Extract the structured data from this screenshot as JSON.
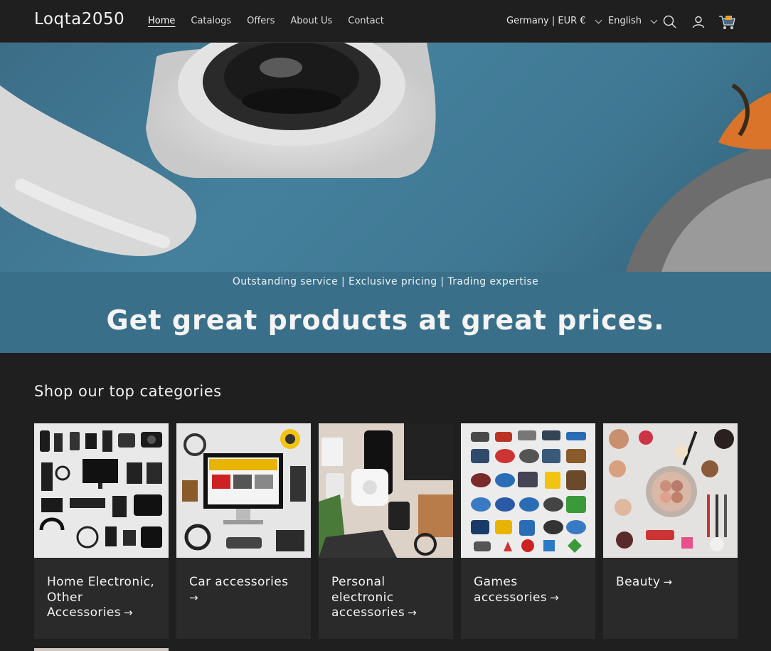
{
  "header": {
    "logo": "Loqta2050",
    "nav": [
      {
        "label": "Home",
        "active": true
      },
      {
        "label": "Catalogs"
      },
      {
        "label": "Offers"
      },
      {
        "label": "About Us"
      },
      {
        "label": "Contact"
      }
    ],
    "locale": "Germany | EUR €",
    "language": "English",
    "icons": [
      "search-icon",
      "account-icon",
      "cart-icon"
    ]
  },
  "announcement": {
    "tagline": "Outstanding service | Exclusive pricing | Trading expertise",
    "headline": "Get great products at great prices."
  },
  "categories": {
    "title": "Shop our top categories",
    "items": [
      {
        "label": "Home Electronic, Other Accessories"
      },
      {
        "label": "Car accessories"
      },
      {
        "label": "Personal electronic accessories"
      },
      {
        "label": "Games accessories"
      },
      {
        "label": "Beauty"
      }
    ]
  },
  "colors": {
    "background": "#1f1f1f",
    "band": "#3a6f8a",
    "card": "#2a2a2a"
  }
}
